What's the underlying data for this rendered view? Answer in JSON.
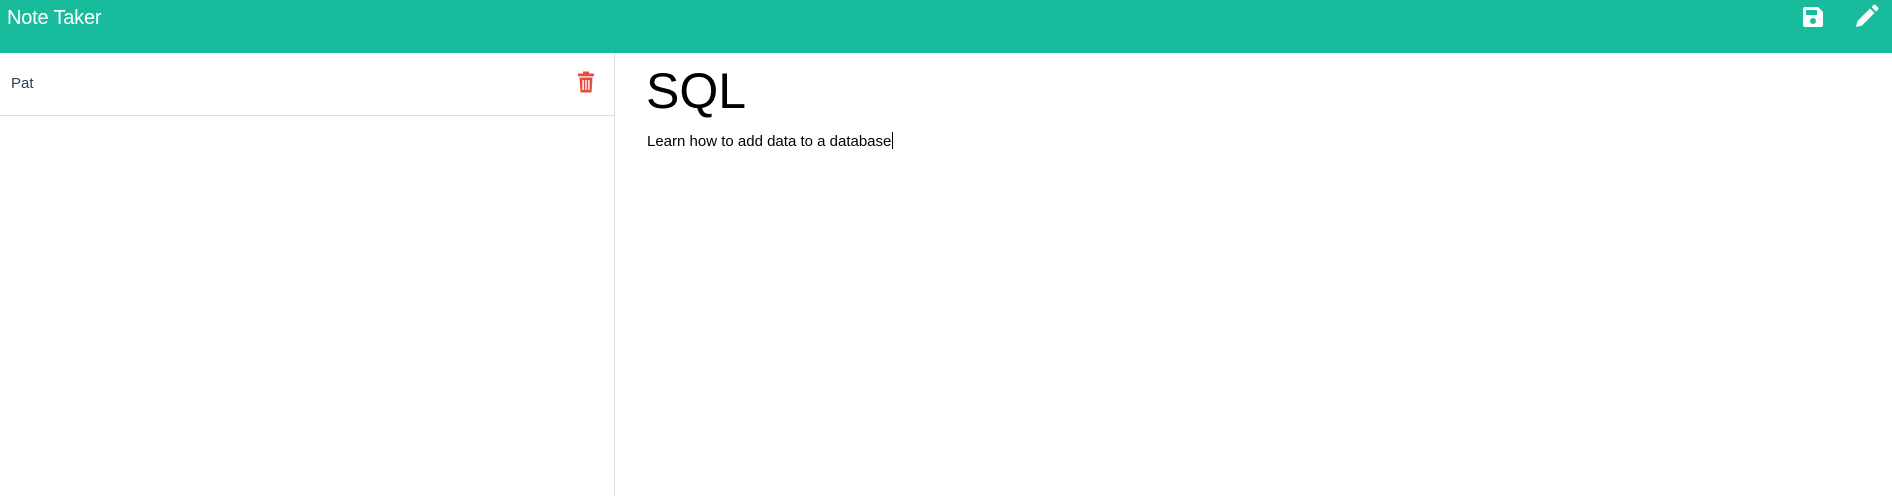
{
  "app": {
    "title": "Note Taker"
  },
  "toolbar": {
    "save_icon": "save-icon",
    "new_note_icon": "pencil-icon",
    "icon_color": "#ffffff",
    "accent_color": "#18bc9c"
  },
  "sidebar": {
    "notes": [
      {
        "title": "Pat",
        "delete_icon": "trash-icon",
        "delete_color": "#e74c3c"
      }
    ]
  },
  "editor": {
    "title": "SQL",
    "text": "Learn how to add data to a database"
  }
}
